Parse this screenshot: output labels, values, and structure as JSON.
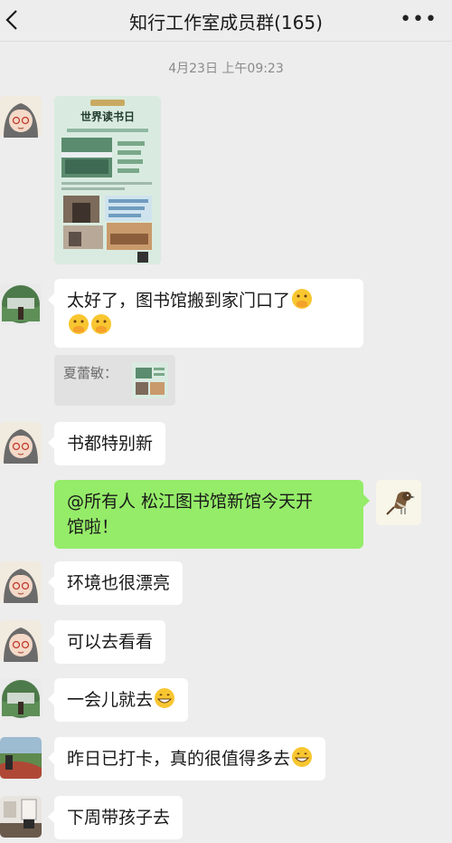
{
  "header": {
    "title": "知行工作室成员群(165)",
    "more_icon": "more-dots-icon",
    "back_icon": "back-chevron-icon"
  },
  "timestamp": "4月23日 上午09:23",
  "poster": {
    "title": "世界读书日"
  },
  "messages": [
    {
      "sender": "other",
      "text": "太好了，图书馆搬到家门口了",
      "text_line2": ""
    },
    {
      "sender": "other",
      "text": "书都特别新"
    },
    {
      "sender": "me",
      "text": "@所有人  松江图书馆新馆今天开",
      "text_line2": "馆啦！"
    },
    {
      "sender": "other",
      "text": "环境也很漂亮"
    },
    {
      "sender": "other",
      "text": "可以去看看"
    },
    {
      "sender": "other",
      "text": "一会儿就去"
    },
    {
      "sender": "other",
      "text": "昨日已打卡，真的很值得多去"
    },
    {
      "sender": "other",
      "text": "下周带孩子去"
    }
  ],
  "quote": {
    "label": "夏蕾敏："
  },
  "colors": {
    "background": "#ededed",
    "my_bubble": "#95ec69",
    "other_bubble": "#ffffff"
  }
}
